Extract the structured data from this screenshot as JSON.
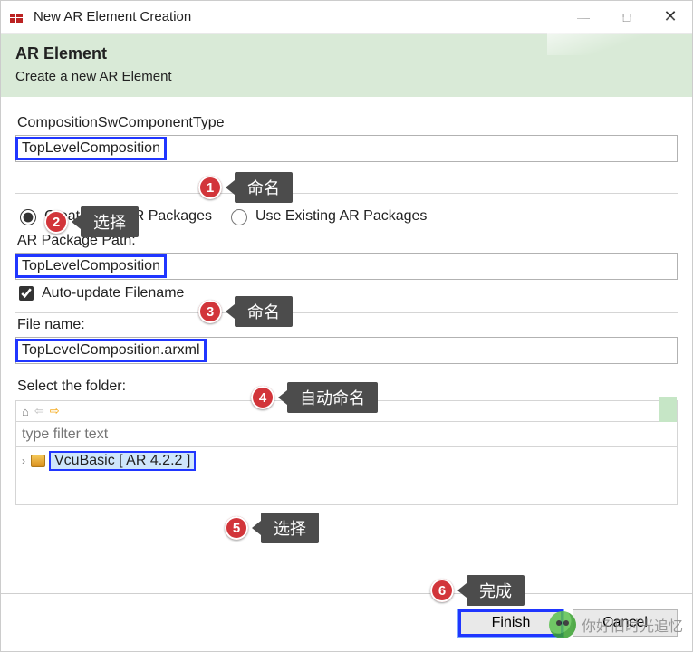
{
  "colors": {
    "accent_highlight": "#2036ff",
    "banner": "#d9ead7",
    "badge": "#d2353a",
    "callout": "#4c4c4c"
  },
  "window": {
    "title": "New AR Element Creation",
    "minimize_glyph": "—",
    "maximize_glyph": "□",
    "close_glyph": "✕"
  },
  "banner": {
    "heading": "AR Element",
    "subheading": "Create a new AR Element"
  },
  "fields": {
    "component_type_label": "CompositionSwComponentType",
    "component_type_value": "TopLevelComposition",
    "radio_create_label": "Create New AR Packages",
    "radio_use_label": "Use Existing AR Packages",
    "radio_selected": "create",
    "pkg_path_label": "AR Package Path:",
    "pkg_path_value": "TopLevelComposition",
    "auto_update_label": "Auto-update Filename",
    "auto_update_checked": true,
    "file_name_label": "File name:",
    "file_name_value": "TopLevelComposition.arxml",
    "select_folder_label": "Select the folder:",
    "filter_placeholder": "type filter text"
  },
  "toolbar_icons": {
    "home": "⌂",
    "back": "⇦",
    "forward": "⇨"
  },
  "tree": {
    "expander_glyph": "›",
    "project_label": "VcuBasic [ AR 4.2.2 ]"
  },
  "buttons": {
    "finish": "Finish",
    "cancel": "Cancel"
  },
  "annotations": [
    {
      "n": "1",
      "label": "命名"
    },
    {
      "n": "2",
      "label": "选择"
    },
    {
      "n": "3",
      "label": "命名"
    },
    {
      "n": "4",
      "label": "自动命名"
    },
    {
      "n": "5",
      "label": "选择"
    },
    {
      "n": "6",
      "label": "完成"
    }
  ],
  "watermark": "你好旧时光追忆"
}
